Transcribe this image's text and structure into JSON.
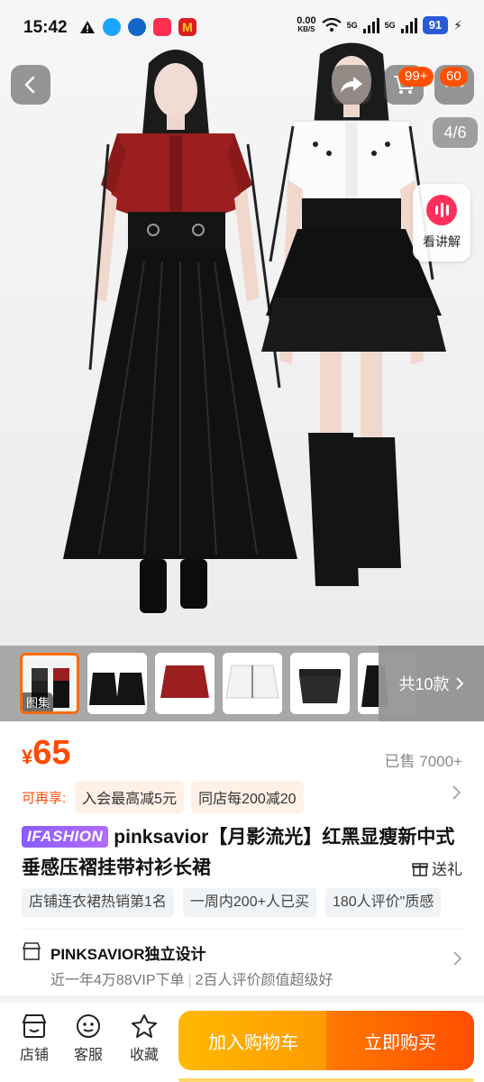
{
  "status_bar": {
    "time": "15:42",
    "speed_value": "0.00",
    "speed_unit": "KB/S",
    "network_1": "5G",
    "network_2": "5G",
    "battery": "91"
  },
  "gallery": {
    "counter": "4/6",
    "cart_badge": "99+",
    "more_badge": "60",
    "explain_label": "看讲解",
    "thumb_caption": "图集",
    "more_styles": "共10款"
  },
  "product": {
    "currency": "¥",
    "price": "65",
    "sold": "已售 7000+",
    "promo_label": "可再享:",
    "promo_chips": [
      "入会最高减5元",
      "同店每200减20"
    ],
    "brand_tag": "IFASHION",
    "title": "pinksavior【月影流光】红黑显瘦新中式垂感压褶挂带衬衫长裙",
    "gift": "送礼",
    "tags": [
      "店铺连衣裙热销第1名",
      "一周内200+人已买",
      "180人评价\"质感"
    ]
  },
  "shop": {
    "name": "PINKSAVIOR独立设计",
    "sub_1": "近一年4万88VIP下单",
    "sub_2": "2百人评价颜值超级好"
  },
  "bottom_bar": {
    "store": "店铺",
    "service": "客服",
    "favorite": "收藏",
    "add_cart": "加入购物车",
    "buy_now": "立即购买"
  },
  "colors": {
    "accent": "#ff4a00",
    "cart_button": "#ffa800",
    "buy_button": "#ff5a00"
  }
}
